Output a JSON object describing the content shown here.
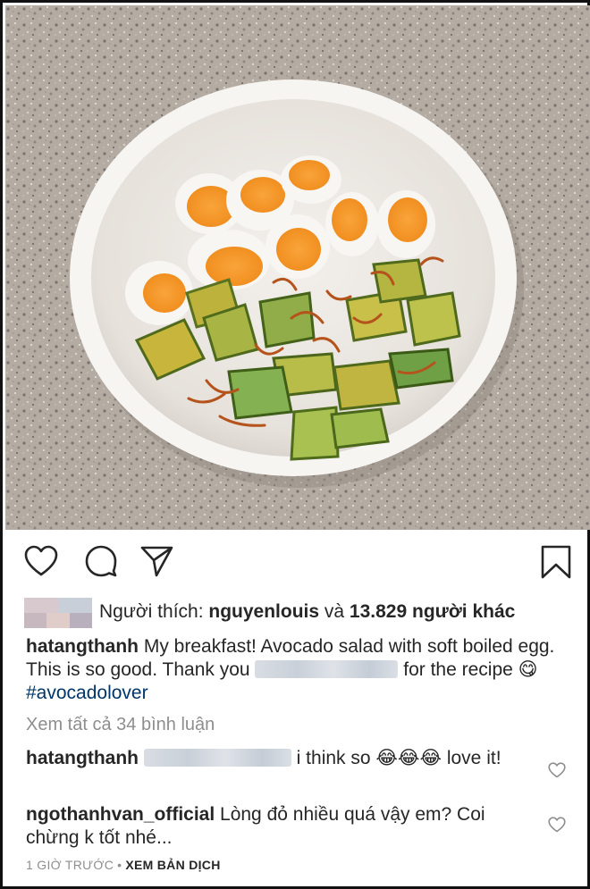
{
  "post": {
    "photo_alt": "hình ảnh bài đăng",
    "likes": {
      "prefix": "Người thích: ",
      "first_user": "nguyenlouis",
      "connector": " và ",
      "others": "13.829 người khác"
    },
    "caption": {
      "username": "hatangthanh",
      "text_1": " My breakfast! Avocado salad with soft boiled egg. This is so good. Thank you ",
      "text_2": " for the recipe ",
      "emoji": "😋",
      "hashtag": "#avocadolover"
    },
    "view_all_comments": "Xem tất cả 34 bình luận",
    "comments": [
      {
        "username": "hatangthanh",
        "text": " i think so 😂😂😂 love it!"
      },
      {
        "username": "ngothanhvan_official",
        "text": " Lòng đỏ nhiều quá vậy em? Coi chừng k tốt nhé..."
      }
    ],
    "timestamp": "1 GIỜ TRƯỚC",
    "separator": "•",
    "translate": "XEM BẢN DỊCH"
  },
  "icons": {
    "like": "heart-outline-icon",
    "comment": "speech-bubble-icon",
    "share": "paper-plane-icon",
    "save": "bookmark-icon",
    "comment_like": "small-heart-icon"
  },
  "colors": {
    "text": "#262626",
    "muted": "#8e8e8e",
    "hashtag": "#003569"
  }
}
